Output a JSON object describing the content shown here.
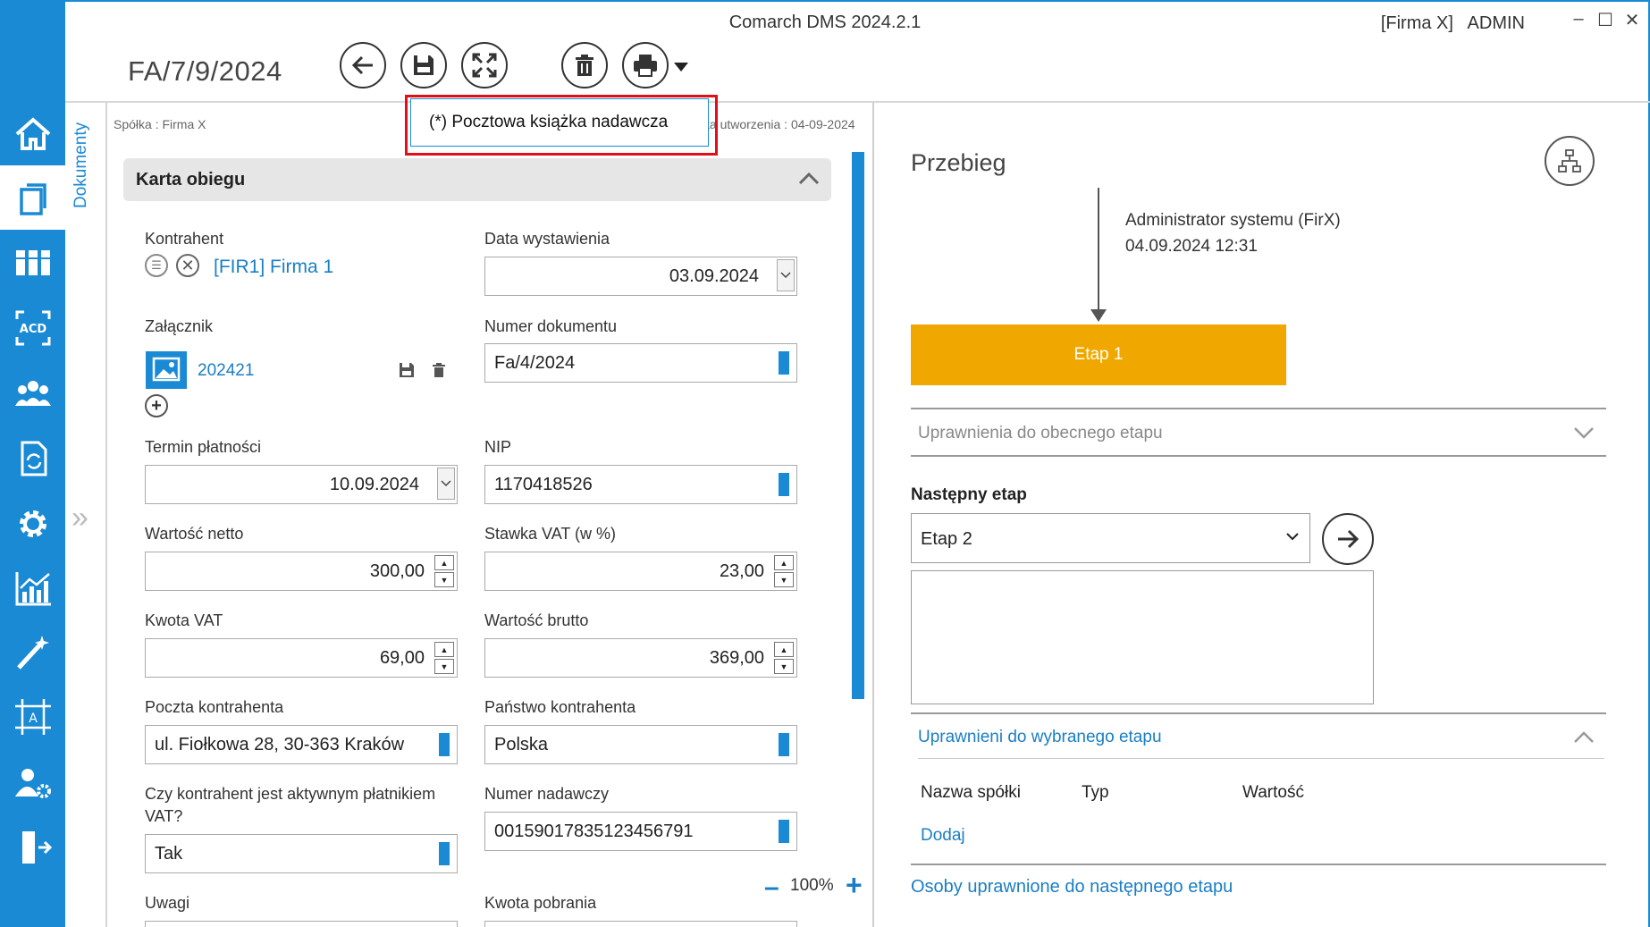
{
  "app": {
    "title": "Comarch DMS 2024.2.1",
    "company": "[Firma X]",
    "user": "ADMIN",
    "window_controls": [
      "–",
      "☐",
      "✕"
    ]
  },
  "nav": {
    "items": [
      "home-icon",
      "documents-icon",
      "workflow-icon",
      "acd-icon",
      "users-icon",
      "refresh-doc-icon",
      "settings-icon",
      "reports-icon",
      "wizard-icon",
      "designer-icon",
      "user-settings-icon",
      "logout-icon"
    ],
    "active_index": 1
  },
  "toolbar": {
    "document_number": "FA/7/9/2024",
    "buttons": [
      "back-icon",
      "save-icon",
      "fullscreen-icon",
      "delete-icon",
      "print-icon"
    ]
  },
  "sidebar_tab": {
    "label": "Dokumenty"
  },
  "doc_meta": {
    "company": "Spółka : Firma X",
    "created": "ta utworzenia : 04-09-2024"
  },
  "popup": {
    "label": "(*) Pocztowa książka nadawcza"
  },
  "card": {
    "title": "Karta obiegu",
    "fields": {
      "kontrahent_label": "Kontrahent",
      "kontrahent_value": "[FIR1] Firma 1",
      "data_wystawienia_label": "Data wystawienia",
      "data_wystawienia_value": "03.09.2024",
      "zalacznik_label": "Załącznik",
      "zalacznik_value": "202421",
      "numer_dokumentu_label": "Numer dokumentu",
      "numer_dokumentu_value": "Fa/4/2024",
      "termin_label": "Termin płatności",
      "termin_value": "10.09.2024",
      "nip_label": "NIP",
      "nip_value": "1170418526",
      "netto_label": "Wartość netto",
      "netto_value": "300,00",
      "vat_rate_label": "Stawka VAT (w %)",
      "vat_rate_value": "23,00",
      "kwota_vat_label": "Kwota VAT",
      "kwota_vat_value": "69,00",
      "brutto_label": "Wartość brutto",
      "brutto_value": "369,00",
      "poczta_label": "Poczta kontrahenta",
      "poczta_value": "ul. Fiołkowa 28, 30-363 Kraków",
      "panstwo_label": "Państwo kontrahenta",
      "panstwo_value": "Polska",
      "vat_payer_label_1": "Czy kontrahent jest aktywnym płatnikiem",
      "vat_payer_label_2": "VAT?",
      "vat_payer_value": "Tak",
      "numer_nadawczy_label": "Numer nadawczy",
      "numer_nadawczy_value": "00159017835123456791",
      "uwagi_label": "Uwagi",
      "kwota_pobrania_label": "Kwota pobrania"
    }
  },
  "zoom": {
    "minus": "–",
    "value": "100%",
    "plus": "+"
  },
  "workflow": {
    "title": "Przebieg",
    "author": "Administrator systemu (FirX)",
    "datetime": "04.09.2024 12:31",
    "current_stage": "Etap 1",
    "permissions_current": "Uprawnienia do obecnego etapu",
    "next_stage_label": "Następny etap",
    "next_stage_value": "Etap 2",
    "permissions_selected": "Uprawnieni do wybranego etapu",
    "columns": [
      "Nazwa spółki",
      "Typ",
      "Wartość"
    ],
    "add_link": "Dodaj",
    "authorized_link": "Osoby uprawnione do następnego etapu"
  }
}
